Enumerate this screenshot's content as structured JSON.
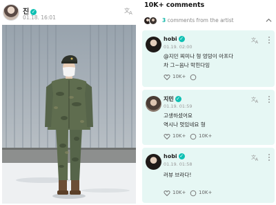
{
  "post": {
    "author": "진",
    "date": "01.18. 16:01"
  },
  "comments_panel": {
    "title": "10K+ comments",
    "artist_count": "3",
    "artist_label": "comments from the artist"
  },
  "comments": [
    {
      "author": "hobi",
      "time": "01.19. 02:00",
      "lines": [
        "@지민 찌미나 형 엉덩이 아프다",
        "차 그~음나 막힌다잉"
      ],
      "likes": "10K+",
      "replies": ""
    },
    {
      "author": "지민",
      "time": "01.19. 01:59",
      "lines": [
        "고생하셨어요",
        "역시나 멋있네요 형"
      ],
      "likes": "10K+",
      "replies": "10K+"
    },
    {
      "author": "hobi",
      "time": "01.19. 01:58",
      "lines": [
        "러뷰 브라다!"
      ],
      "likes": "10K+",
      "replies": "10K+"
    }
  ],
  "icons": {
    "verified": "verified-badge-icon",
    "translate": "translate-icon",
    "more": "more-vertical-icon",
    "collapse": "chevron-up-icon",
    "like": "heart-icon",
    "reply": "comment-bubble-icon"
  },
  "colors": {
    "accent": "#0fc0b3",
    "card_bg": "#e6f7f4"
  }
}
